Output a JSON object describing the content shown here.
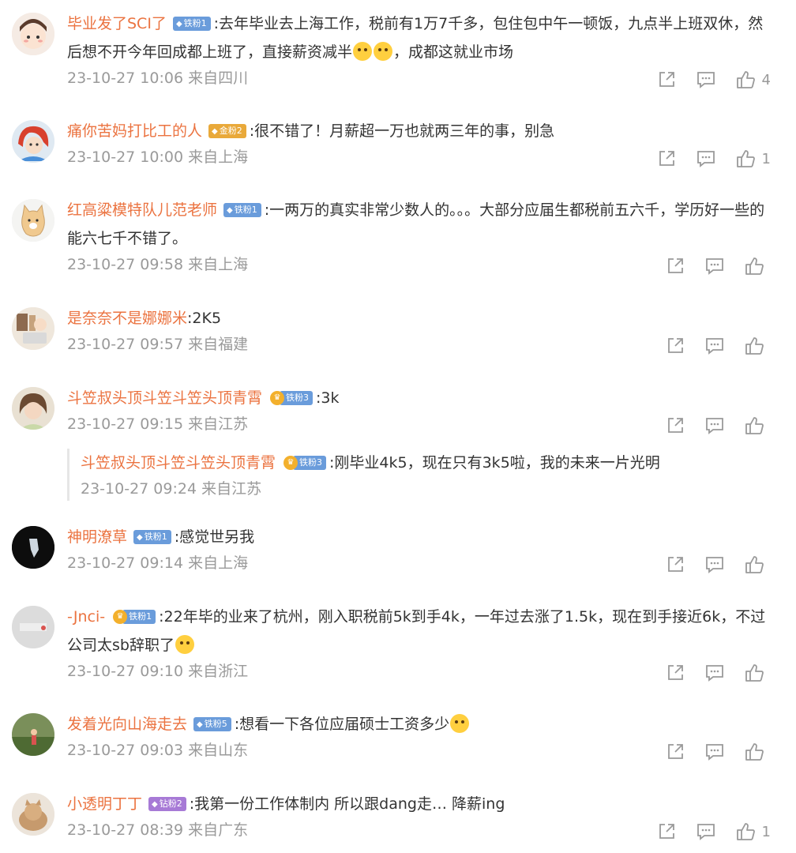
{
  "comments": [
    {
      "name": "毕业发了SCI了",
      "badge": "铁粉1",
      "badge_kind": "blue",
      "text_parts": [
        ":去年毕业去上海工作，税前有1万7千多，包住包中午一顿饭，九点半上班双休，然后想不开今年回成都上班了，直接薪资减半",
        "，成都这就业市场"
      ],
      "time": "23-10-27 10:06 来自四川",
      "likes": "4"
    },
    {
      "name": "痛你苦妈打比工的人",
      "badge": "金粉2",
      "badge_kind": "gold",
      "text": ":很不错了！月薪超一万也就两三年的事，别急",
      "time": "23-10-27 10:00 来自上海",
      "likes": "1"
    },
    {
      "name": "红高粱模特队儿范老师",
      "badge": "铁粉1",
      "badge_kind": "blue",
      "text": ":一两万的真实非常少数人的。。。大部分应届生都税前五六千，学历好一些的能六七千不错了。",
      "time": "23-10-27 09:58 来自上海",
      "likes": ""
    },
    {
      "name": "是奈奈不是娜娜米",
      "badge": "",
      "badge_kind": "",
      "text": ":2K5",
      "time": "23-10-27 09:57 来自福建",
      "likes": ""
    },
    {
      "name": "斗笠叔头顶斗笠斗笠头顶青霄",
      "badge": "铁粉3",
      "badge_kind": "rich",
      "text": ":3k",
      "time": "23-10-27 09:15 来自江苏",
      "likes": "",
      "reply": {
        "name": "斗笠叔头顶斗笠斗笠头顶青霄",
        "badge": "铁粉3",
        "text": ":刚毕业4k5，现在只有3k5啦，我的未来一片光明",
        "time": "23-10-27 09:24 来自江苏"
      }
    },
    {
      "name": "神明潦草",
      "badge": "铁粉1",
      "badge_kind": "blue",
      "text": ":感觉世另我",
      "time": "23-10-27 09:14 来自上海",
      "likes": ""
    },
    {
      "name": "-Jnci-",
      "badge": "铁粉1",
      "badge_kind": "rich",
      "text": ":22年毕的业来了杭州，刚入职税前5k到手4k，一年过去涨了1.5k，现在到手接近6k，不过公司太sb辞职了",
      "time": "23-10-27 09:10 来自浙江",
      "likes": ""
    },
    {
      "name": "发着光向山海走去",
      "badge": "铁粉5",
      "badge_kind": "blue",
      "text": ":想看一下各位应届硕士工资多少",
      "time": "23-10-27 09:03 来自山东",
      "likes": ""
    },
    {
      "name": "小透明丁丁",
      "badge": "钻粉2",
      "badge_kind": "purple",
      "text": ":我第一份工作体制内 所以跟dang走… 降薪ing",
      "time": "23-10-27 08:39 来自广东",
      "likes": "1"
    }
  ],
  "icons": {
    "share": "share-icon",
    "comment": "comment-icon",
    "like": "thumbs-up-icon"
  }
}
